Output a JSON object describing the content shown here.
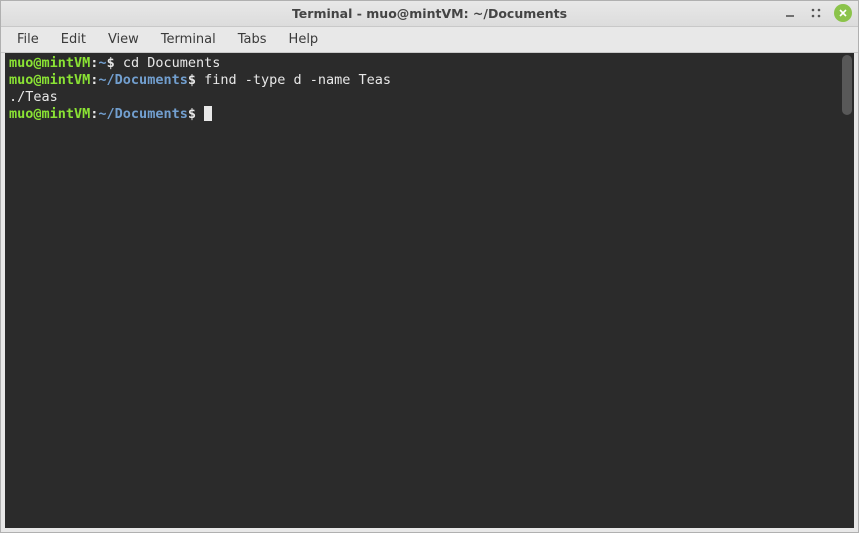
{
  "window": {
    "title": "Terminal - muo@mintVM: ~/Documents"
  },
  "menubar": {
    "items": [
      "File",
      "Edit",
      "View",
      "Terminal",
      "Tabs",
      "Help"
    ]
  },
  "terminal": {
    "lines": [
      {
        "prompt": {
          "user": "muo@mintVM",
          "path": "~"
        },
        "command": "cd Documents"
      },
      {
        "prompt": {
          "user": "muo@mintVM",
          "path": "~/Documents"
        },
        "command": "find -type d -name Teas"
      },
      {
        "output": "./Teas"
      },
      {
        "prompt": {
          "user": "muo@mintVM",
          "path": "~/Documents"
        },
        "command": "",
        "cursor": true
      }
    ]
  }
}
